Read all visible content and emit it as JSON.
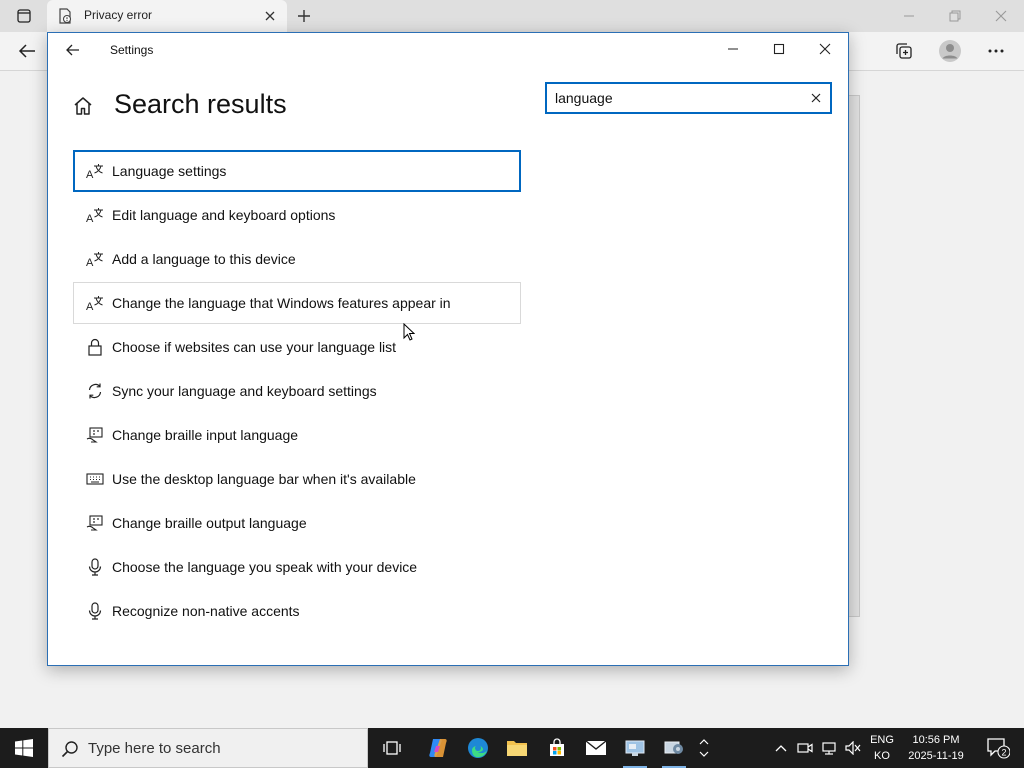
{
  "browser": {
    "tab_title": "Privacy error"
  },
  "settings": {
    "window_title": "Settings",
    "page_title": "Search results",
    "search": {
      "value": "language"
    },
    "results": [
      {
        "label": "Language settings",
        "icon": "language-icon",
        "state": "selected"
      },
      {
        "label": "Edit language and keyboard options",
        "icon": "language-icon",
        "state": "normal"
      },
      {
        "label": "Add a language to this device",
        "icon": "language-icon",
        "state": "normal"
      },
      {
        "label": "Change the language that Windows features appear in",
        "icon": "language-icon",
        "state": "hover"
      },
      {
        "label": "Choose if websites can use your language list",
        "icon": "lock-icon",
        "state": "normal"
      },
      {
        "label": "Sync your language and keyboard settings",
        "icon": "sync-icon",
        "state": "normal"
      },
      {
        "label": "Change braille input language",
        "icon": "braille-icon",
        "state": "normal"
      },
      {
        "label": "Use the desktop language bar when it's available",
        "icon": "keyboard-icon",
        "state": "normal"
      },
      {
        "label": "Change braille output language",
        "icon": "braille-icon",
        "state": "normal"
      },
      {
        "label": "Choose the language you speak with your device",
        "icon": "microphone-icon",
        "state": "normal"
      },
      {
        "label": "Recognize non-native accents",
        "icon": "microphone-icon",
        "state": "normal"
      }
    ]
  },
  "taskbar": {
    "search_placeholder": "Type here to search",
    "lang_line1": "ENG",
    "lang_line2": "KO",
    "time": "10:56 PM",
    "date": "2025-11-19",
    "notification_count": "2"
  },
  "colors": {
    "accent": "#0067c0",
    "taskbar": "#1c1c1c"
  }
}
